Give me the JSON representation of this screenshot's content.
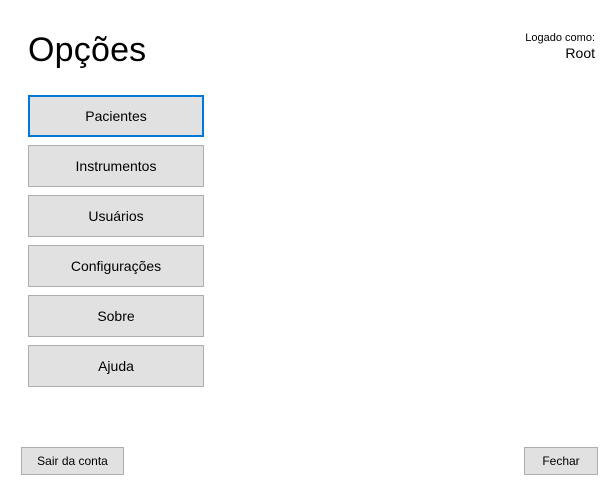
{
  "window": {
    "title": "Opções"
  },
  "login": {
    "caption": "Logado como:",
    "user": "Root"
  },
  "menu": {
    "items": [
      {
        "label": "Pacientes"
      },
      {
        "label": "Instrumentos"
      },
      {
        "label": "Usuários"
      },
      {
        "label": "Configurações"
      },
      {
        "label": "Sobre"
      },
      {
        "label": "Ajuda"
      }
    ]
  },
  "footer": {
    "logout_label": "Sair da conta",
    "close_label": "Fechar"
  },
  "colors": {
    "button_face": "#e1e1e1",
    "button_border": "#adadad",
    "focus_border": "#0078d7"
  }
}
